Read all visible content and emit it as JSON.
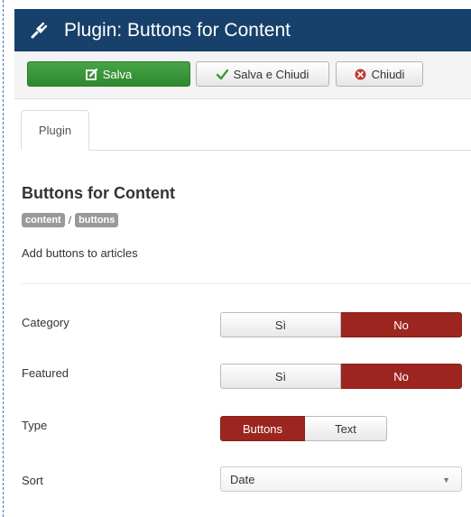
{
  "header": {
    "icon": "plug-icon",
    "title": "Plugin: Buttons for Content",
    "background": "#17406b"
  },
  "toolbar": {
    "save_label": "Salva",
    "save_close_label": "Salva e Chiudi",
    "close_label": "Chiudi",
    "save_color": "#3a9a3a",
    "close_icon_color": "#c0392b"
  },
  "tabs": [
    {
      "label": "Plugin",
      "active": true
    }
  ],
  "plugin": {
    "name": "Buttons for Content",
    "tags": [
      "content",
      "buttons"
    ],
    "tag_separator": "/",
    "description": "Add buttons to articles"
  },
  "fields": {
    "category": {
      "label": "Category",
      "options": [
        "Sì",
        "No"
      ],
      "selected": "No"
    },
    "featured": {
      "label": "Featured",
      "options": [
        "Sì",
        "No"
      ],
      "selected": "No"
    },
    "type": {
      "label": "Type",
      "options": [
        "Buttons",
        "Text"
      ],
      "selected": "Buttons"
    },
    "sort": {
      "label": "Sort",
      "value": "Date"
    }
  },
  "colors": {
    "active_toggle": "#9c261f"
  }
}
